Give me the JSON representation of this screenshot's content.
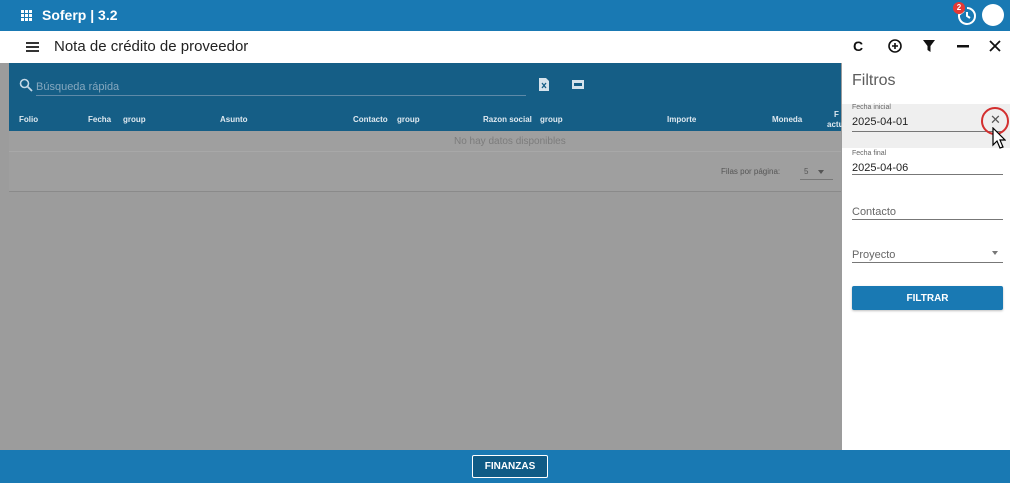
{
  "app": {
    "title": "Soferp | 3.2",
    "notification_count": "2"
  },
  "page": {
    "title": "Nota de crédito de proveedor"
  },
  "toolbar": {
    "icons": [
      "refresh-icon",
      "add-icon",
      "filter-icon",
      "minimize-icon",
      "close-icon"
    ]
  },
  "table": {
    "search_placeholder": "Búsqueda rápida",
    "columns": [
      "Folio",
      "Fecha",
      "group",
      "Asunto",
      "Contacto",
      "group",
      "Razon social",
      "group",
      "Importe",
      "Moneda",
      "F",
      "actu"
    ],
    "empty_message": "No hay datos disponibles",
    "rows_per_page_label": "Filas por página:",
    "rows_per_page_value": "5"
  },
  "filters": {
    "title": "Filtros",
    "fecha_inicial": {
      "label": "Fecha inicial",
      "value": "2025-04-01"
    },
    "fecha_final": {
      "label": "Fecha final",
      "value": "2025-04-06"
    },
    "contacto": {
      "placeholder": "Contacto"
    },
    "proyecto": {
      "placeholder": "Proyecto"
    },
    "submit_label": "FILTRAR"
  },
  "footer": {
    "tab_label": "FINANZAS"
  },
  "colors": {
    "primary": "#1979b3",
    "header_dark": "#155e86",
    "overlay": "#9c9c9c",
    "badge": "#e53935",
    "highlight_ring": "#d32f2f"
  }
}
